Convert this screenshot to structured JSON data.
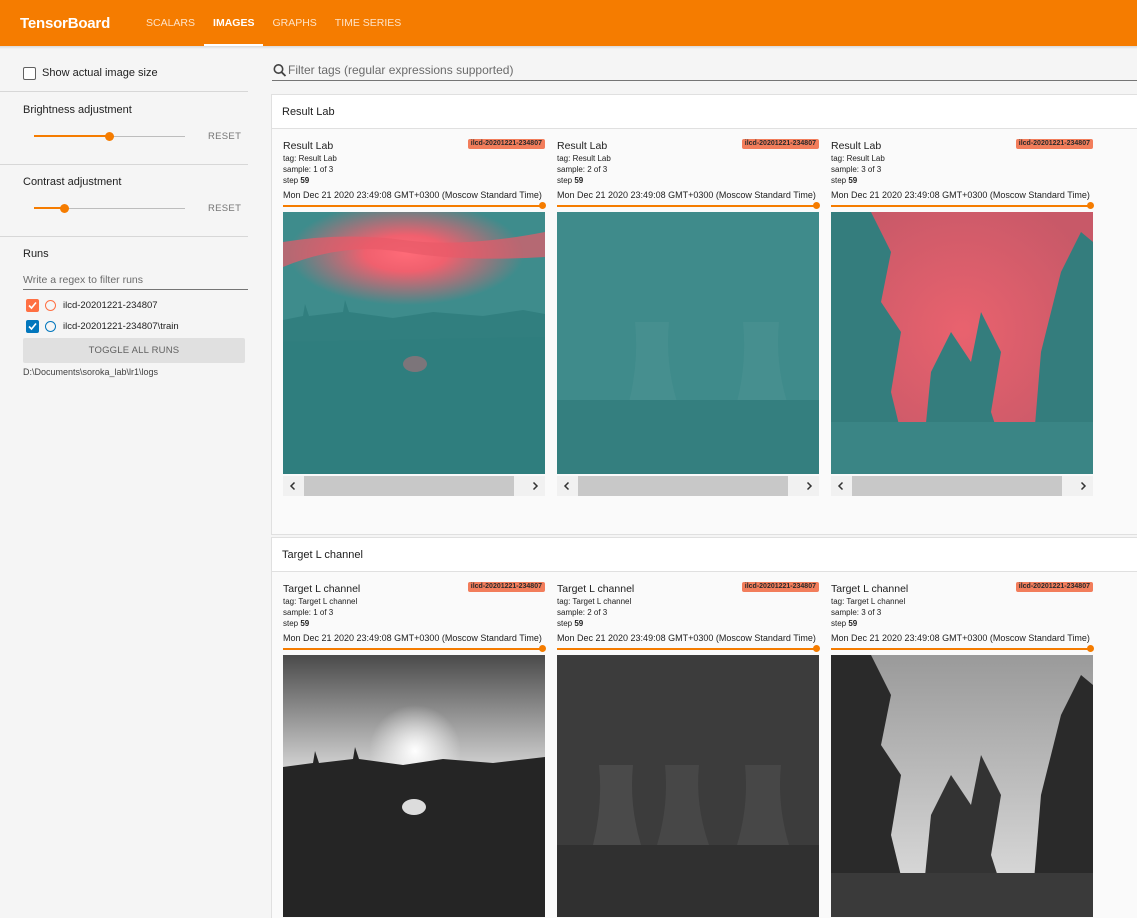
{
  "app": {
    "title": "TensorBoard",
    "tabs": [
      {
        "label": "SCALARS",
        "active": false
      },
      {
        "label": "IMAGES",
        "active": true
      },
      {
        "label": "GRAPHS",
        "active": false
      },
      {
        "label": "TIME SERIES",
        "active": false
      }
    ]
  },
  "sidebar": {
    "show_actual_size": {
      "label": "Show actual image size",
      "checked": false
    },
    "brightness": {
      "label": "Brightness adjustment",
      "reset": "RESET",
      "value": 0.5
    },
    "contrast": {
      "label": "Contrast adjustment",
      "reset": "RESET",
      "value": 0.2
    },
    "runs": {
      "title": "Runs",
      "filter_placeholder": "Write a regex to filter runs",
      "items": [
        {
          "name": "ilcd-20201221-234807",
          "checked": true,
          "color": "#ff7043"
        },
        {
          "name": "ilcd-20201221-234807\\train",
          "checked": true,
          "color": "#0277bd"
        }
      ],
      "toggle_all": "TOGGLE ALL RUNS",
      "logdir": "D:\\Documents\\soroka_lab\\lr1\\logs"
    }
  },
  "tag_filter": {
    "placeholder": "Filter tags (regular expressions supported)"
  },
  "sections": [
    {
      "title": "Result Lab",
      "cards": [
        {
          "title": "Result Lab",
          "run": "ilcd-20201221-234807",
          "tag": "tag: Result Lab",
          "sample": "sample: 1 of 3",
          "step_label": "step",
          "step": "59",
          "time": "Mon Dec 21 2020 23:49:08 GMT+0300 (Moscow Standard Time)",
          "image": "sunset-field-lab"
        },
        {
          "title": "Result Lab",
          "run": "ilcd-20201221-234807",
          "tag": "tag: Result Lab",
          "sample": "sample: 2 of 3",
          "step_label": "step",
          "step": "59",
          "time": "Mon Dec 21 2020 23:49:08 GMT+0300 (Moscow Standard Time)",
          "image": "cooling-towers-lab"
        },
        {
          "title": "Result Lab",
          "run": "ilcd-20201221-234807",
          "tag": "tag: Result Lab",
          "sample": "sample: 3 of 3",
          "step_label": "step",
          "step": "59",
          "time": "Mon Dec 21 2020 23:49:08 GMT+0300 (Moscow Standard Time)",
          "image": "forest-lab"
        }
      ]
    },
    {
      "title": "Target L channel",
      "cards": [
        {
          "title": "Target L channel",
          "run": "ilcd-20201221-234807",
          "tag": "tag: Target L channel",
          "sample": "sample: 1 of 3",
          "step_label": "step",
          "step": "59",
          "time": "Mon Dec 21 2020 23:49:08 GMT+0300 (Moscow Standard Time)",
          "image": "sunset-field-gray"
        },
        {
          "title": "Target L channel",
          "run": "ilcd-20201221-234807",
          "tag": "tag: Target L channel",
          "sample": "sample: 2 of 3",
          "step_label": "step",
          "step": "59",
          "time": "Mon Dec 21 2020 23:49:08 GMT+0300 (Moscow Standard Time)",
          "image": "cooling-towers-gray"
        },
        {
          "title": "Target L channel",
          "run": "ilcd-20201221-234807",
          "tag": "tag: Target L channel",
          "sample": "sample: 3 of 3",
          "step_label": "step",
          "step": "59",
          "time": "Mon Dec 21 2020 23:49:08 GMT+0300 (Moscow Standard Time)",
          "image": "forest-gray"
        }
      ]
    }
  ]
}
